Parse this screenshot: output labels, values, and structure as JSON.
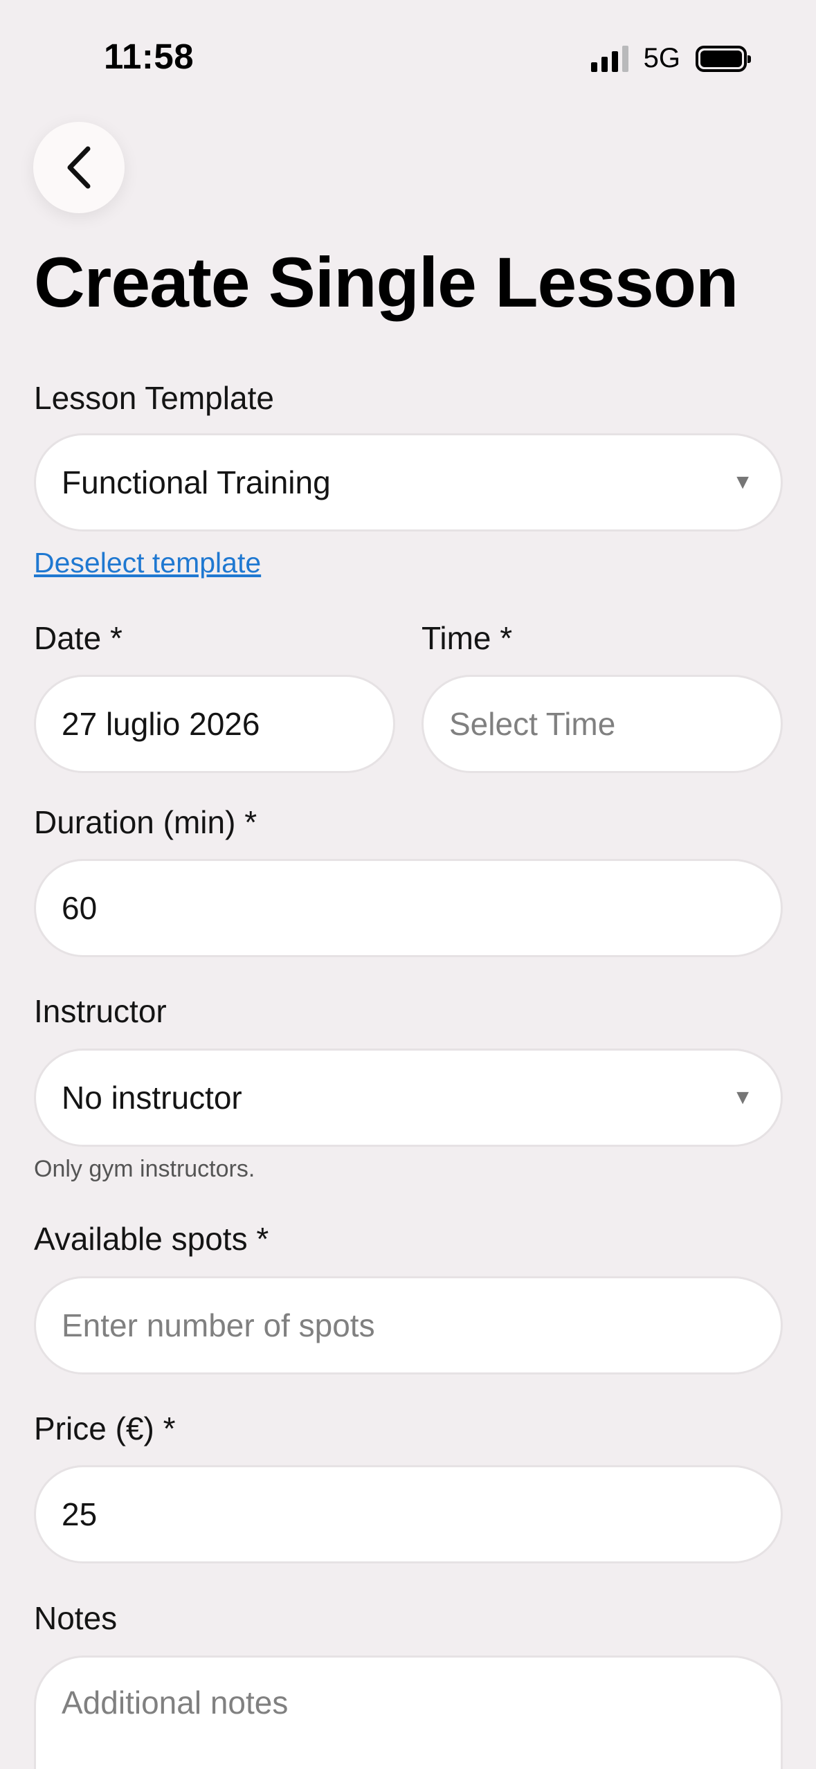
{
  "status_bar": {
    "time": "11:58",
    "network": "5G",
    "signal_bars": 3,
    "signal_total": 4
  },
  "header": {
    "back_icon": "chevron-left-icon",
    "title": "Create Single Lesson"
  },
  "form": {
    "lesson_template": {
      "label": "Lesson Template",
      "value": "Functional Training",
      "caret": "▼"
    },
    "deselect_link": "Deselect template",
    "date": {
      "label": "Date *",
      "value": "27 luglio 2026"
    },
    "time": {
      "label": "Time *",
      "placeholder": "Select Time"
    },
    "duration": {
      "label": "Duration (min) *",
      "value": "60"
    },
    "instructor": {
      "label": "Instructor",
      "value": "No instructor",
      "caret": "▼",
      "hint": "Only gym instructors."
    },
    "spots": {
      "label": "Available spots *",
      "placeholder": "Enter number of spots"
    },
    "price": {
      "label": "Price (€) *",
      "value": "25"
    },
    "notes": {
      "label": "Notes",
      "placeholder": "Additional notes"
    }
  },
  "colors": {
    "background": "#f2eef0",
    "link": "#1f78d1",
    "field_border": "#e6e2e4"
  }
}
